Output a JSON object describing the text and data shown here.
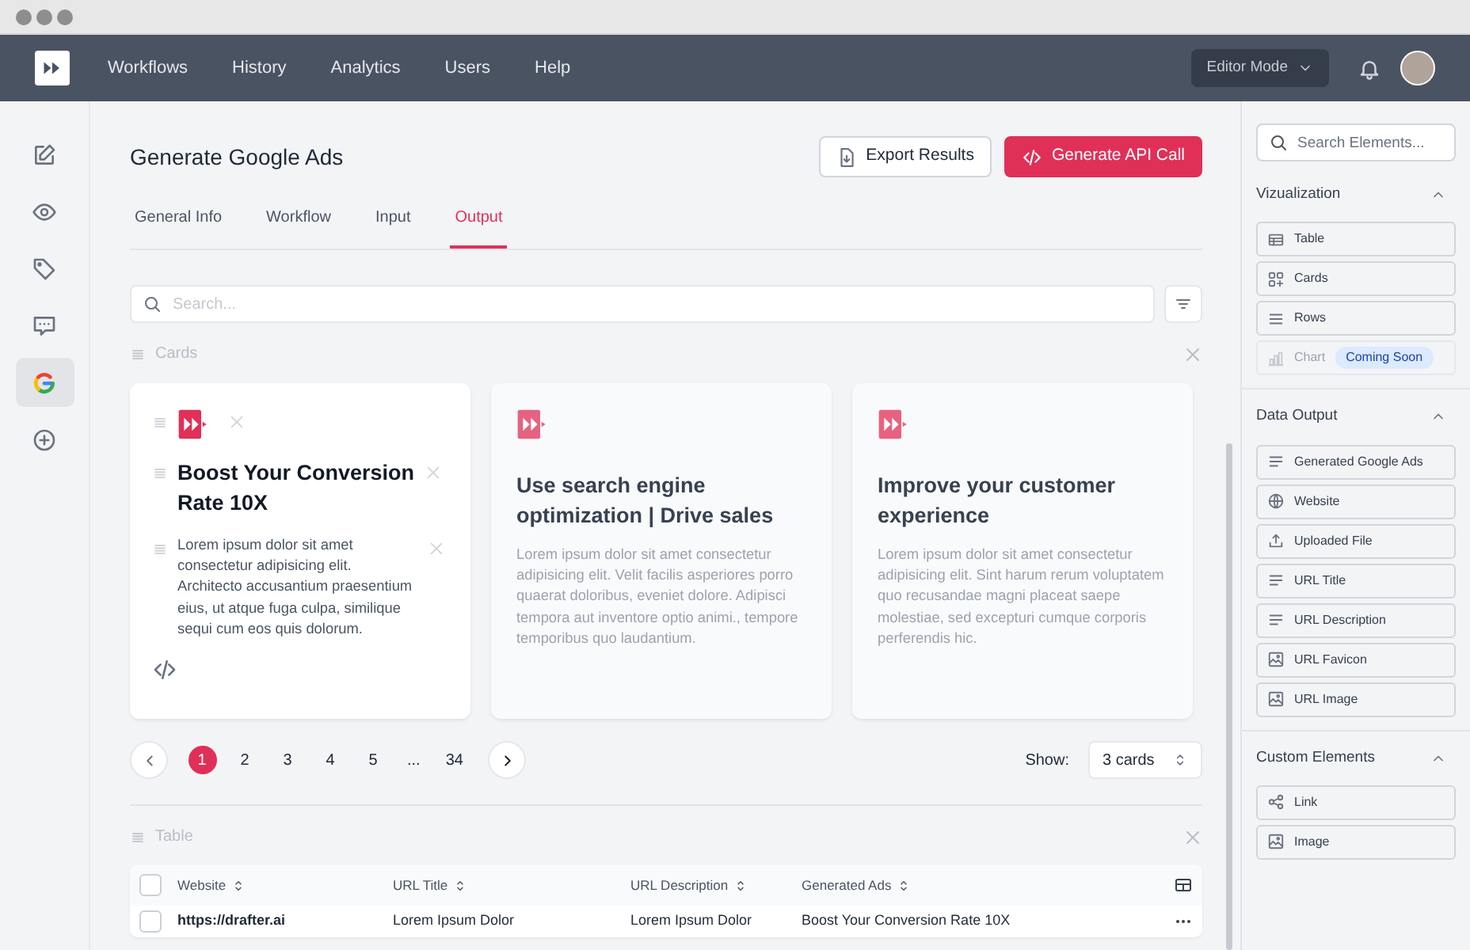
{
  "navbar": {
    "menu": [
      {
        "label": "Workflows"
      },
      {
        "label": "History"
      },
      {
        "label": "Analytics"
      },
      {
        "label": "Users"
      },
      {
        "label": "Help"
      }
    ],
    "mode_button": "Editor Mode"
  },
  "rail_items": [
    {
      "kind": "edit",
      "selected": false
    },
    {
      "kind": "view",
      "selected": false
    },
    {
      "kind": "tag",
      "selected": false
    },
    {
      "kind": "comment",
      "selected": false
    },
    {
      "kind": "google",
      "selected": true
    },
    {
      "kind": "add",
      "selected": false
    }
  ],
  "page": {
    "title": "Generate Google Ads",
    "actions": [
      {
        "label": "Export Results",
        "kind": "outline"
      },
      {
        "label": "Generate API Call",
        "kind": "primary"
      }
    ]
  },
  "tabs": [
    {
      "label": "General Info",
      "selected": false
    },
    {
      "label": "Workflow",
      "selected": false
    },
    {
      "label": "Input",
      "selected": false
    },
    {
      "label": "Output",
      "selected": true
    }
  ],
  "search": {
    "placeholder": "Search..."
  },
  "cards_section": {
    "label": "Cards",
    "cards": [
      {
        "title": "Boost Your Conversion Rate 10X",
        "body": "Lorem ipsum dolor sit amet consectetur adipisicing elit. Architecto accusantium praesentium eius, ut atque fuga culpa, similique sequi cum eos quis dolorum.",
        "selected": true
      },
      {
        "title": "Use search engine optimization | Drive sales",
        "body": "Lorem ipsum dolor sit amet consectetur adipisicing elit. Velit facilis asperiores porro quaerat doloribus, eveniet dolore. Adipisci tempora aut inventore optio animi., tempore temporibus quo laudantium.",
        "selected": false
      },
      {
        "title": "Improve your customer experience",
        "body": "Lorem ipsum dolor sit amet consectetur adipisicing elit. Sint harum rerum voluptatem quo recusandae magni placeat saepe molestiae, sed excepturi cumque corporis perferendis hic.",
        "selected": false
      }
    ]
  },
  "pagination": {
    "pages": [
      {
        "label": "1",
        "selected": true
      },
      {
        "label": "2",
        "selected": false
      },
      {
        "label": "3",
        "selected": false
      },
      {
        "label": "4",
        "selected": false
      },
      {
        "label": "5",
        "selected": false
      },
      {
        "label": "...",
        "selected": false
      },
      {
        "label": "34",
        "selected": false
      }
    ],
    "show_label": "Show:",
    "show_value": "3 cards"
  },
  "table_section": {
    "label": "Table",
    "header_checked": false,
    "columns": [
      "Website",
      "URL Title",
      "URL Description",
      "Generated Ads"
    ],
    "rows": [
      {
        "checked": false,
        "cells": [
          "https://drafter.ai",
          "Lorem Ipsum Dolor",
          "Lorem Ipsum Dolor",
          "Boost Your Conversion Rate 10X"
        ]
      }
    ]
  },
  "elements_panel": {
    "search_placeholder": "Search Elements...",
    "groups": [
      {
        "title": "Vizualization",
        "expanded": true,
        "items": [
          {
            "label": "Table",
            "kind": "table",
            "disabled": false
          },
          {
            "label": "Cards",
            "kind": "cards",
            "disabled": false
          },
          {
            "label": "Rows",
            "kind": "rows",
            "disabled": false
          },
          {
            "label": "Chart",
            "kind": "chart",
            "disabled": true,
            "badge": "Coming Soon"
          }
        ]
      },
      {
        "title": "Data Output",
        "expanded": true,
        "items": [
          {
            "label": "Generated Google Ads",
            "kind": "text",
            "disabled": false
          },
          {
            "label": "Website",
            "kind": "globe",
            "disabled": false
          },
          {
            "label": "Uploaded File",
            "kind": "upload",
            "disabled": false
          },
          {
            "label": "URL Title",
            "kind": "text",
            "disabled": false
          },
          {
            "label": "URL Description",
            "kind": "text",
            "disabled": false
          },
          {
            "label": "URL Favicon",
            "kind": "image",
            "disabled": false
          },
          {
            "label": "URL Image",
            "kind": "image",
            "disabled": false
          }
        ]
      },
      {
        "title": "Custom Elements",
        "expanded": true,
        "items": [
          {
            "label": "Link",
            "kind": "share",
            "disabled": false
          },
          {
            "label": "Image",
            "kind": "image",
            "disabled": false
          }
        ]
      }
    ]
  }
}
